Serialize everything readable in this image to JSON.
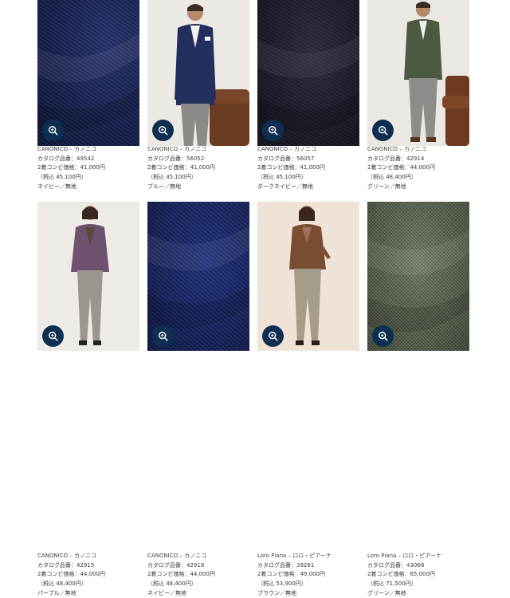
{
  "products": [
    {
      "id": "p1",
      "brand": "CANONICO – カノニコ",
      "catalog": "カタログ品番：49542",
      "price": "2着コンビ価格：41,000円",
      "tax": "（税込 45,100円）",
      "color": "ネイビー／無地",
      "image": "navy-fabric"
    },
    {
      "id": "p2",
      "brand": "CANONICO – カノニコ",
      "catalog": "カタログ品番：56052",
      "price": "2着コンビ価格：41,000円",
      "tax": "（税込 45,100円）",
      "color": "ブルー／無地",
      "image": "man-navy-jacket"
    },
    {
      "id": "p3",
      "brand": "CANONICO – カノニコ",
      "catalog": "カタログ品番：56057",
      "price": "2着コンビ価格：41,000円",
      "tax": "（税込 45,100円）",
      "color": "ダークネイビー／無地",
      "image": "dark-navy-fabric"
    },
    {
      "id": "p4",
      "brand": "CANONICO – カノニコ",
      "catalog": "カタログ品番：42914",
      "price": "2着コンビ価格：44,000円",
      "tax": "（税込 48,400円）",
      "color": "グリーン／無地",
      "image": "man-green-jacket"
    },
    {
      "id": "p5",
      "brand": "CANONICO – カノニコ",
      "catalog": "カタログ品番：42915",
      "price": "2着コンビ価格：44,000円",
      "tax": "（税込 48,400円）",
      "color": "パープル／無地",
      "image": "woman-purple-jacket"
    },
    {
      "id": "p6",
      "brand": "CANONICO – カノニコ",
      "catalog": "カタログ品番：42918",
      "price": "2着コンビ価格：44,000円",
      "tax": "（税込 48,400円）",
      "color": "ネイビー／無地",
      "image": "navy-fabric"
    },
    {
      "id": "p7",
      "brand": "Loro Piana – ロロ・ピアーナ",
      "catalog": "カタログ品番：39261",
      "price": "2着コンビ価格：49,000円",
      "tax": "（税込 53,900円）",
      "color": "ブラウン／無地",
      "image": "woman-brown-jacket"
    },
    {
      "id": "p8",
      "brand": "Loro Piana – ロロ・ピアーナ",
      "catalog": "カタログ品番：43068",
      "price": "2着コンビ価格：65,000円",
      "tax": "（税込 71,500円）",
      "color": "グリーン／無地",
      "image": "green-tweed-fabric"
    }
  ],
  "colors": {
    "zoom_button": "#0f2f52"
  },
  "icons": {
    "zoom": "magnify-plus-icon"
  }
}
